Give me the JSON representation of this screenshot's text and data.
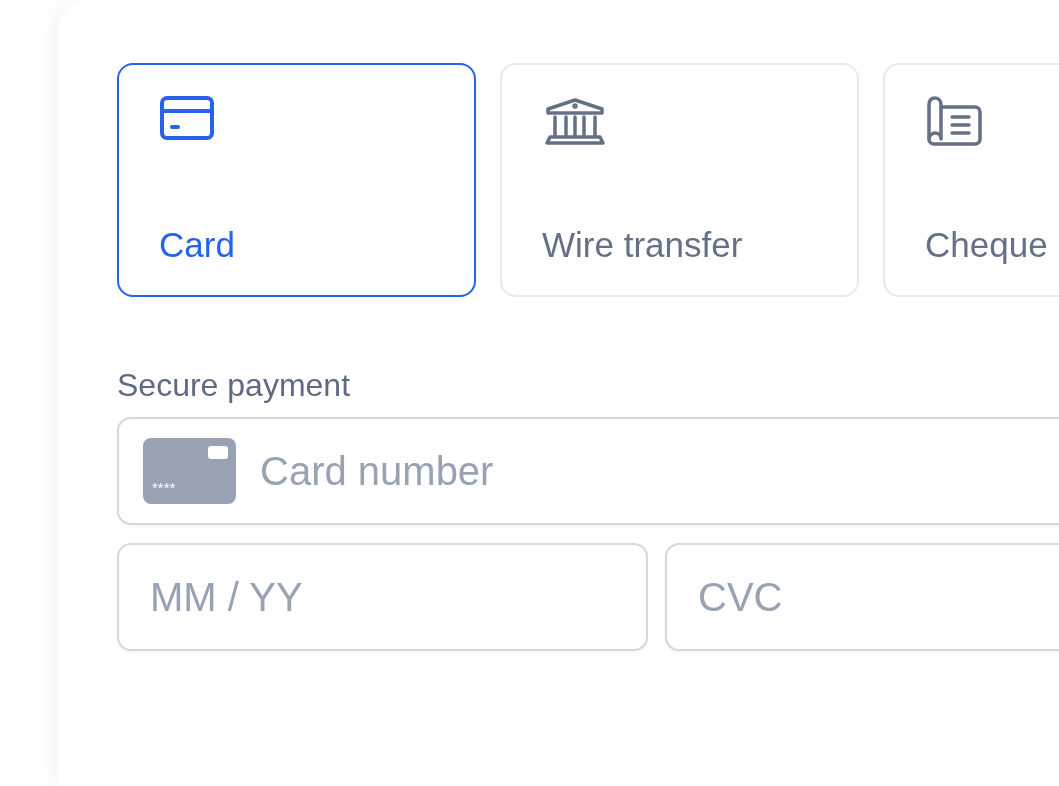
{
  "payment_methods": [
    {
      "label": "Card",
      "kind": "card",
      "selected": true
    },
    {
      "label": "Wire transfer",
      "kind": "bank",
      "selected": false
    },
    {
      "label": "Cheque",
      "kind": "cheque",
      "selected": false
    }
  ],
  "section_label": "Secure payment",
  "card_number": {
    "placeholder": "Card number",
    "icon_mask": "****"
  },
  "expiry": {
    "placeholder": "MM / YY"
  },
  "cvc": {
    "placeholder": "CVC"
  }
}
